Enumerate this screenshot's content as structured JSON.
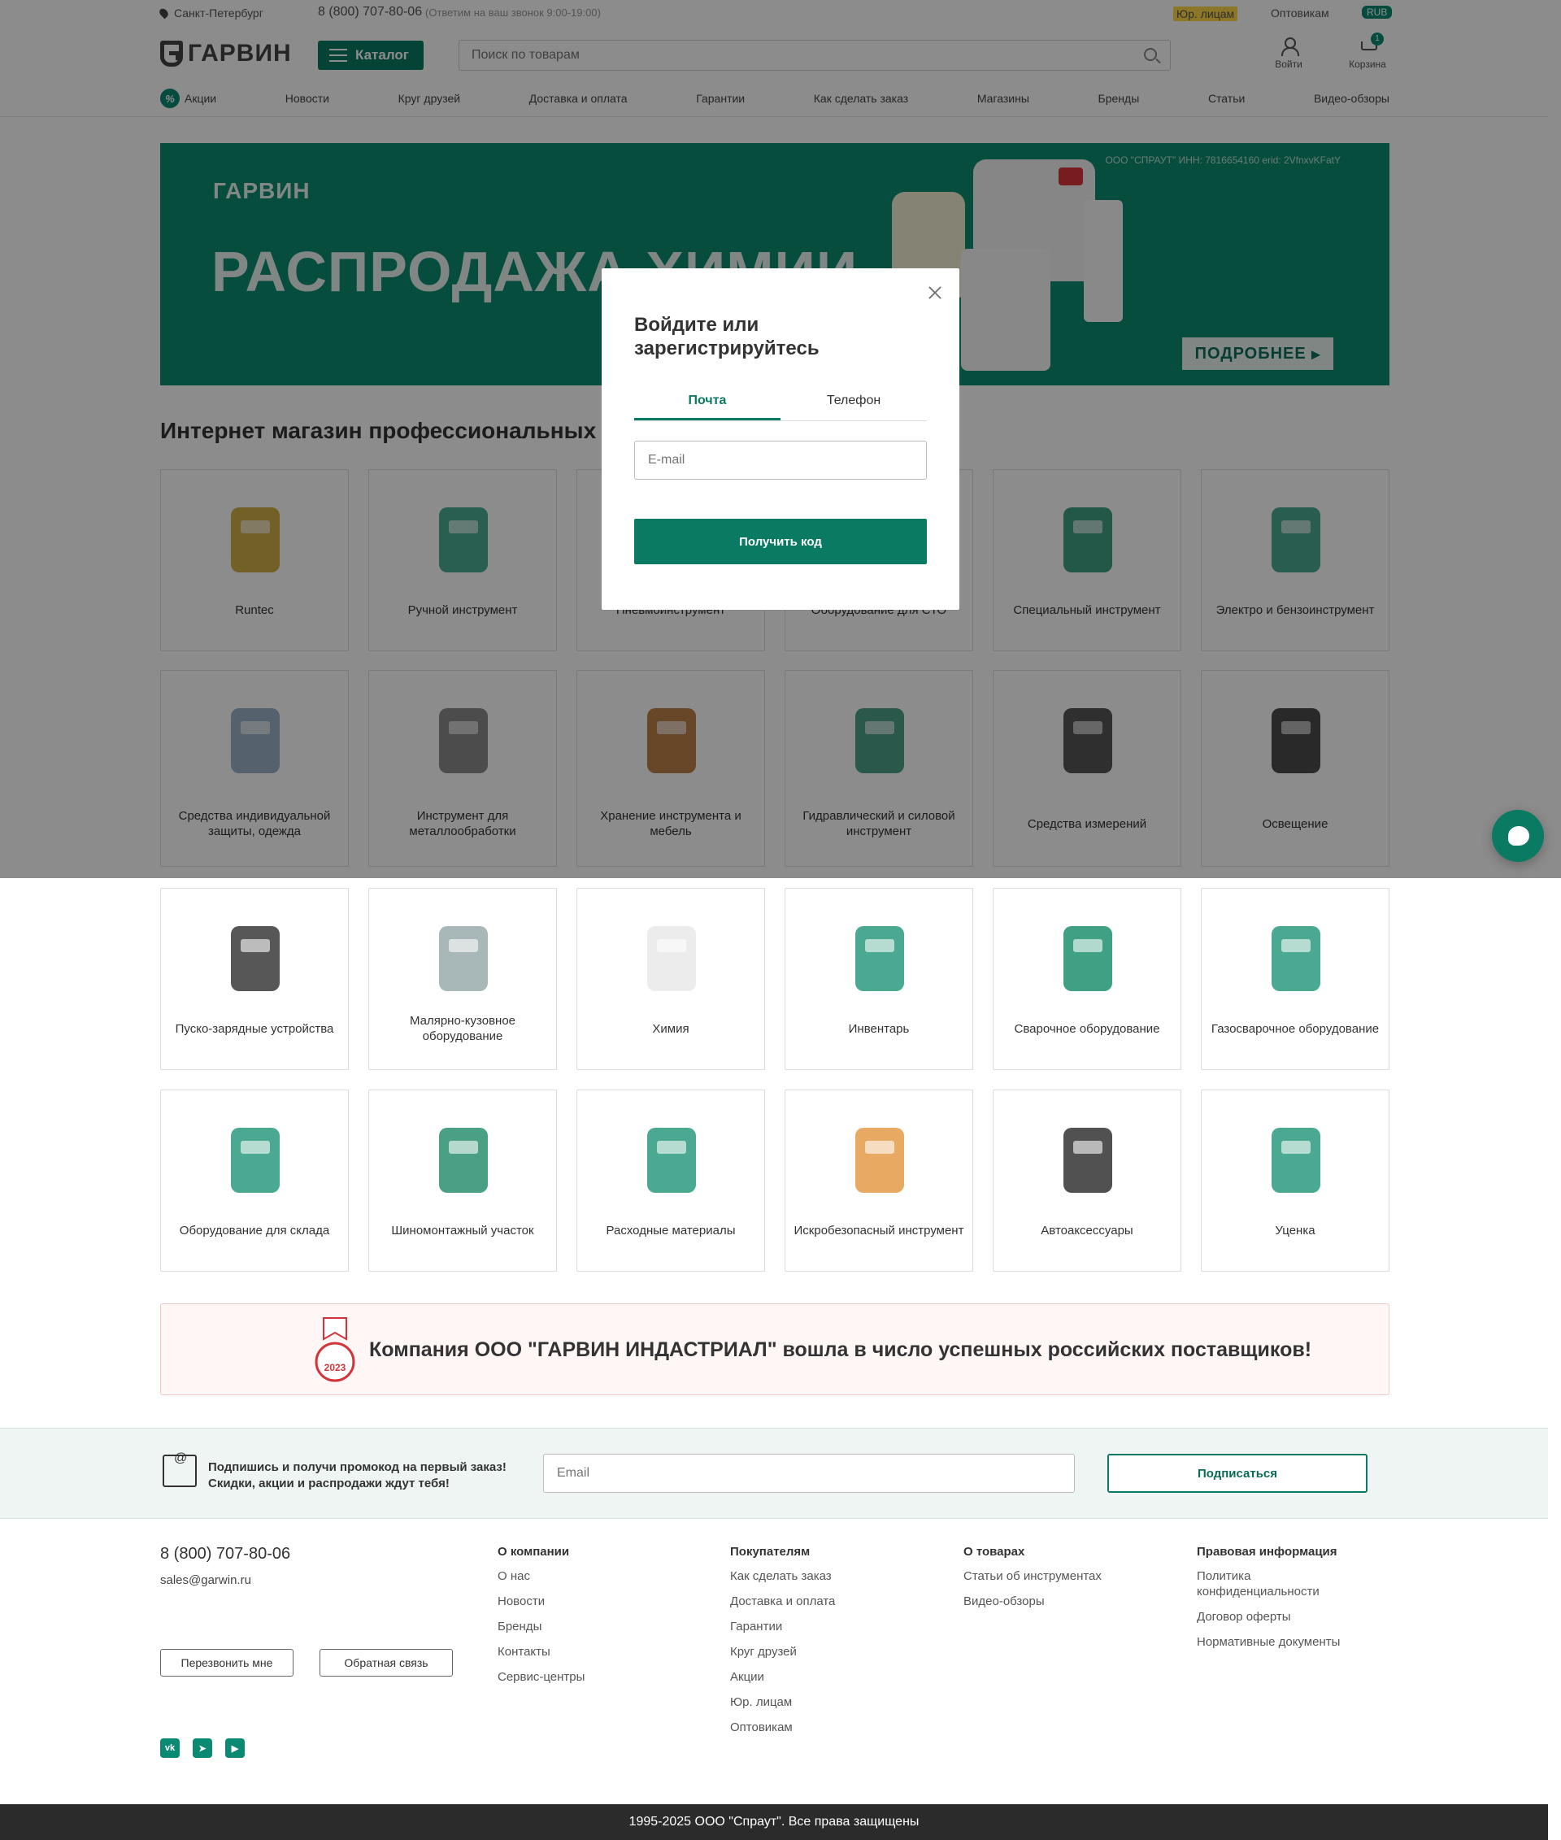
{
  "header": {
    "city": "Санкт-Петербург",
    "phone": "8 (800) 707-80-06",
    "phone_note": "(Ответим на ваш звонок 9:00-19:00)",
    "jur_link": "Юр. лицам",
    "wholesale_link": "Оптовикам",
    "currency": "RUB",
    "logo": "ГАРВИН",
    "catalog_label": "Каталог",
    "search_placeholder": "Поиск по товарам",
    "login_label": "Войти",
    "cart_label": "Корзина",
    "cart_count": "1"
  },
  "nav": [
    "Акции",
    "Новости",
    "Круг друзей",
    "Доставка и оплата",
    "Гарантии",
    "Как сделать заказ",
    "Магазины",
    "Бренды",
    "Статьи",
    "Видео-обзоры"
  ],
  "banner": {
    "logo": "ГАРВИН",
    "title": "РАСПРОДАЖА ХИМИИ",
    "legal": "ООО \"СПРАУТ\" ИНН: 7816654160 erid: 2VfnxvKFatY",
    "more": "ПОДРОБНЕЕ"
  },
  "section_title": "Интернет магазин профессиональных инструментов",
  "categories": [
    "Runtec",
    "Ручной инструмент",
    "Пневмоинструмент",
    "Оборудование для СТО",
    "Специальный инструмент",
    "Электро и бензоинструмент",
    "Средства индивидуальной защиты, одежда",
    "Инструмент для металлообработки",
    "Хранение инструмента и мебель",
    "Гидравлический и силовой инструмент",
    "Средства измерений",
    "Освещение",
    "Пуско-зарядные устройства",
    "Малярно-кузовное оборудование",
    "Химия",
    "Инвентарь",
    "Сварочное оборудование",
    "Газосварочное оборудование",
    "Оборудование для склада",
    "Шиномонтажный участок",
    "Расходные материалы",
    "Искробезопасный инструмент",
    "Автоаксессуары",
    "Уценка"
  ],
  "modal": {
    "title": "Войдите или зарегистрируйтесь",
    "tab_email": "Почта",
    "tab_phone": "Телефон",
    "email_placeholder": "E-mail",
    "submit": "Получить код"
  },
  "award": {
    "badge_text": "успешные поставщики 2023",
    "text": "Компания ООО \"ГАРВИН ИНДАСТРИАЛ\" вошла в число успешных российских поставщиков!"
  },
  "subscribe": {
    "line1": "Подпишись и получи промокод на первый заказ!",
    "line2": "Скидки, акции и распродажи ждут тебя!",
    "placeholder": "Email",
    "button": "Подписаться"
  },
  "footer": {
    "phone": "8 (800) 707-80-06",
    "email": "sales@garwin.ru",
    "callback": "Перезвонить мне",
    "feedback": "Обратная связь",
    "columns": [
      {
        "title": "О компании",
        "items": [
          "О нас",
          "Новости",
          "Бренды",
          "Контакты",
          "Сервис-центры"
        ]
      },
      {
        "title": "Покупателям",
        "items": [
          "Как сделать заказ",
          "Доставка и оплата",
          "Гарантии",
          "Круг друзей",
          "Акции",
          "Юр. лицам",
          "Оптовикам"
        ]
      },
      {
        "title": "О товарах",
        "items": [
          "Статьи об инструментах",
          "Видео-обзоры"
        ]
      },
      {
        "title": "Правовая информация",
        "items": [
          "Политика конфиденциальности",
          "Договор оферты",
          "Нормативные документы"
        ]
      }
    ],
    "social": [
      "vk-icon",
      "telegram-icon",
      "youtube-icon"
    ],
    "copyright": "1995-2025 ООО \"Спраут\". Все права защищены"
  },
  "colors": {
    "brand": "#0a7a63",
    "accent": "#0b8c72",
    "dark": "#2b2b2b"
  }
}
